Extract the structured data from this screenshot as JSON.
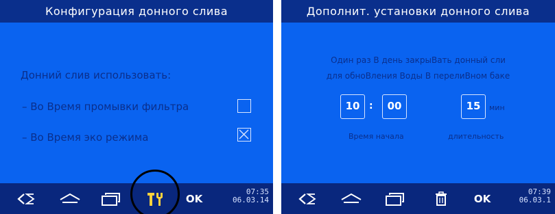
{
  "left": {
    "title": "Конфигурация донного слива",
    "section_label": "Донний слив использовать:",
    "options": [
      {
        "label": "– Во Время промывки фильтра",
        "checked": false
      },
      {
        "label": "– Во Время эко режима",
        "checked": true
      }
    ],
    "toolbar": {
      "icons": [
        "back-icon",
        "home-icon",
        "windows-icon",
        "tools-icon"
      ],
      "ok_label": "OK",
      "time": "07:35",
      "date": "06.03.14"
    }
  },
  "right": {
    "title": "Дополнит. установки донного слива",
    "note_line1": "Один раз В день закрыВать донный сли",
    "note_line2": "для обноВления Воды В перелиВном баке",
    "hours": "10",
    "minutes": "00",
    "duration": "15",
    "duration_unit": "мин",
    "start_time_label": "Время начала",
    "duration_label": "длительность",
    "toolbar": {
      "icons": [
        "back-icon",
        "home-icon",
        "windows-icon",
        "trash-icon"
      ],
      "ok_label": "OK",
      "time": "07:39",
      "date": "06.03.1"
    }
  },
  "colors": {
    "screen": "#0a63f0",
    "titlebar": "#0a2f8c",
    "toolbar": "#09277d",
    "text_dark": "#0a2f8c",
    "highlight_ring": "#000000"
  }
}
